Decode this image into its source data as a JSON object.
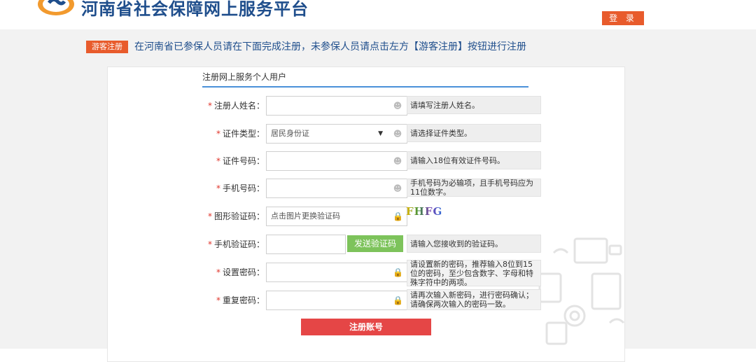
{
  "header": {
    "logo_icon": "si-logo-icon",
    "site_title": "河南省社会保障网上服务平台",
    "login_label": "登 录"
  },
  "notice": {
    "guest_label": "游客注册",
    "text": "在河南省已参保人员请在下面完成注册，未参保人员请点击左方【游客注册】按钮进行注册"
  },
  "form": {
    "section_title": "注册网上服务个人用户",
    "required_mark": "*",
    "fields": [
      {
        "label": "注册人姓名：",
        "value": "",
        "hint": "请填写注册人姓名。",
        "icon": "user-icon"
      },
      {
        "label": "证件类型：",
        "value": "居民身份证",
        "hint": "请选择证件类型。",
        "icon": "user-icon"
      },
      {
        "label": "证件号码：",
        "value": "",
        "hint": "请输入18位有效证件号码。",
        "icon": "user-icon"
      },
      {
        "label": "手机号码：",
        "value": "",
        "hint": "手机号码为必输项，且手机号码应为11位数字。",
        "icon": "user-icon"
      },
      {
        "label": "图形验证码：",
        "placeholder": "点击图片更换验证码",
        "hint": "",
        "icon": "lock-icon"
      },
      {
        "label": "手机验证码：",
        "value": "",
        "hint": "请输入您接收到的验证码。"
      },
      {
        "label": "设置密码：",
        "value": "",
        "hint": "请设置新的密码，推荐输入8位到15位的密码，至少包含数字、字母和特殊字符中的两项。",
        "icon": "lock-icon"
      },
      {
        "label": "重复密码：",
        "value": "",
        "hint": "请再次输入新密码，进行密码确认；请确保两次输入的密码一致。",
        "icon": "lock-icon"
      }
    ],
    "captcha_text": "FHFG",
    "send_code_label": "发送验证码",
    "submit_label": "注册账号"
  },
  "colors": {
    "accent_orange": "#e85b2c",
    "title_blue": "#1f4e8c",
    "required_red": "#e0352b",
    "send_green": "#7dc35b",
    "submit_red": "#e54646"
  }
}
